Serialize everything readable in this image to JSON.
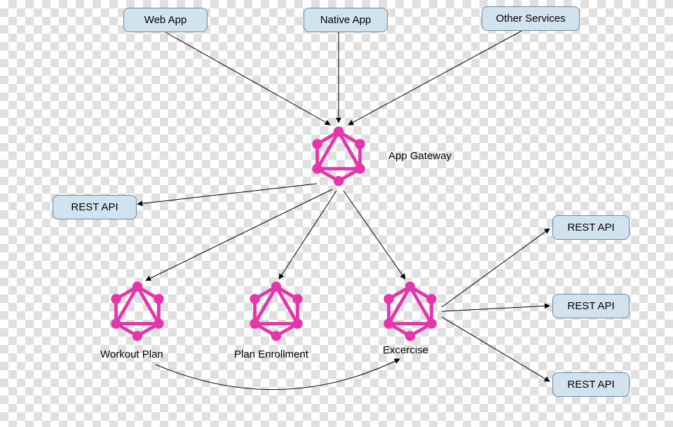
{
  "clients": {
    "web_app": "Web App",
    "native_app": "Native App",
    "other_services": "Other Services"
  },
  "gateway": {
    "label": "App Gateway"
  },
  "left_api": "REST API",
  "services": {
    "workout_plan": "Workout Plan",
    "plan_enrollment": "Plan Enrollment",
    "excercise": "Excercise"
  },
  "right_apis": [
    "REST API",
    "REST API",
    "REST API"
  ],
  "colors": {
    "graphql_pink": "#e535ab",
    "box_fill": "#d2e3f0",
    "box_border": "#6d879c",
    "arrow": "#000000"
  }
}
